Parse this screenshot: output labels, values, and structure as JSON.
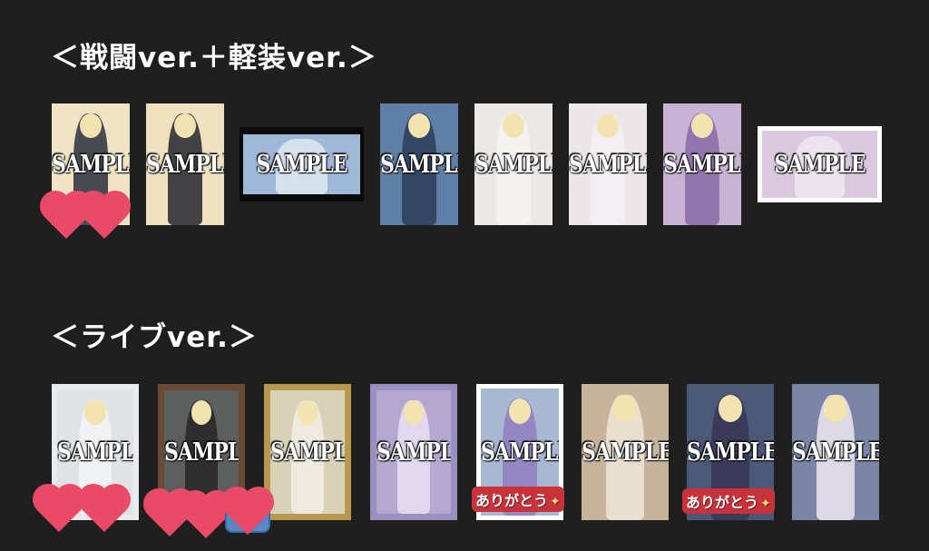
{
  "section1": {
    "title": "＜戦闘ver.＋軽装ver.＞",
    "cards": [
      {
        "watermark": "SAMPLE",
        "bg": "#efe3c4",
        "frame": "none",
        "figure": "#2a2f3e"
      },
      {
        "watermark": "SAMPLE",
        "bg": "#efe0bf",
        "frame": "none",
        "figure": "#23262f"
      },
      {
        "watermark": "SAMPLE",
        "bg": "#9fb8d8",
        "frame": "black",
        "figure": "#dfe8f2"
      },
      {
        "watermark": "SAMPLE",
        "bg": "#5f7fa6",
        "frame": "none",
        "figure": "#2b3c58"
      },
      {
        "watermark": "SAMPLE",
        "bg": "#ece8e6",
        "frame": "none",
        "figure": "#f7f5f2"
      },
      {
        "watermark": "SAMPLE",
        "bg": "#ece6e8",
        "frame": "none",
        "figure": "#f4eef2"
      },
      {
        "watermark": "SAMPLE",
        "bg": "#c9b3d4",
        "frame": "none",
        "figure": "#8a6aa6"
      },
      {
        "watermark": "SAMPLE",
        "bg": "#d9c8de",
        "frame": "plain",
        "figure": "#efe7f1"
      }
    ]
  },
  "section2": {
    "title": "＜ライブver.＞",
    "cards": [
      {
        "watermark": "SAMPLE",
        "bg": "#dfe3e6",
        "frame": "white",
        "figure": "#f3f3f3"
      },
      {
        "watermark": "SAMPLE",
        "bg": "#5c5f5e",
        "frame": "brown",
        "figure": "#262626"
      },
      {
        "watermark": "SAMPLE",
        "bg": "#d9d2b9",
        "frame": "gold",
        "figure": "#f1efe6"
      },
      {
        "watermark": "SAMPLE",
        "bg": "#b4a8d0",
        "frame": "purple",
        "figure": "#e9e1f3"
      },
      {
        "watermark": "SAMPLE",
        "bg": "#a8b7d2",
        "frame": "plain",
        "figure": "#8f7fbf"
      },
      {
        "watermark": "SAMPLE",
        "bg": "#c8b49a",
        "frame": "none",
        "figure": "#efe6da"
      },
      {
        "watermark": "SAMPLE",
        "bg": "#4b5878",
        "frame": "none",
        "figure": "#3a3554"
      },
      {
        "watermark": "SAMPLE",
        "bg": "#7b86a6",
        "frame": "none",
        "figure": "#ede8ee"
      }
    ]
  },
  "stickers": {
    "heart_color": "#e94a68",
    "arigato_text": "ありがとう",
    "sparkle_icon": "✦"
  }
}
